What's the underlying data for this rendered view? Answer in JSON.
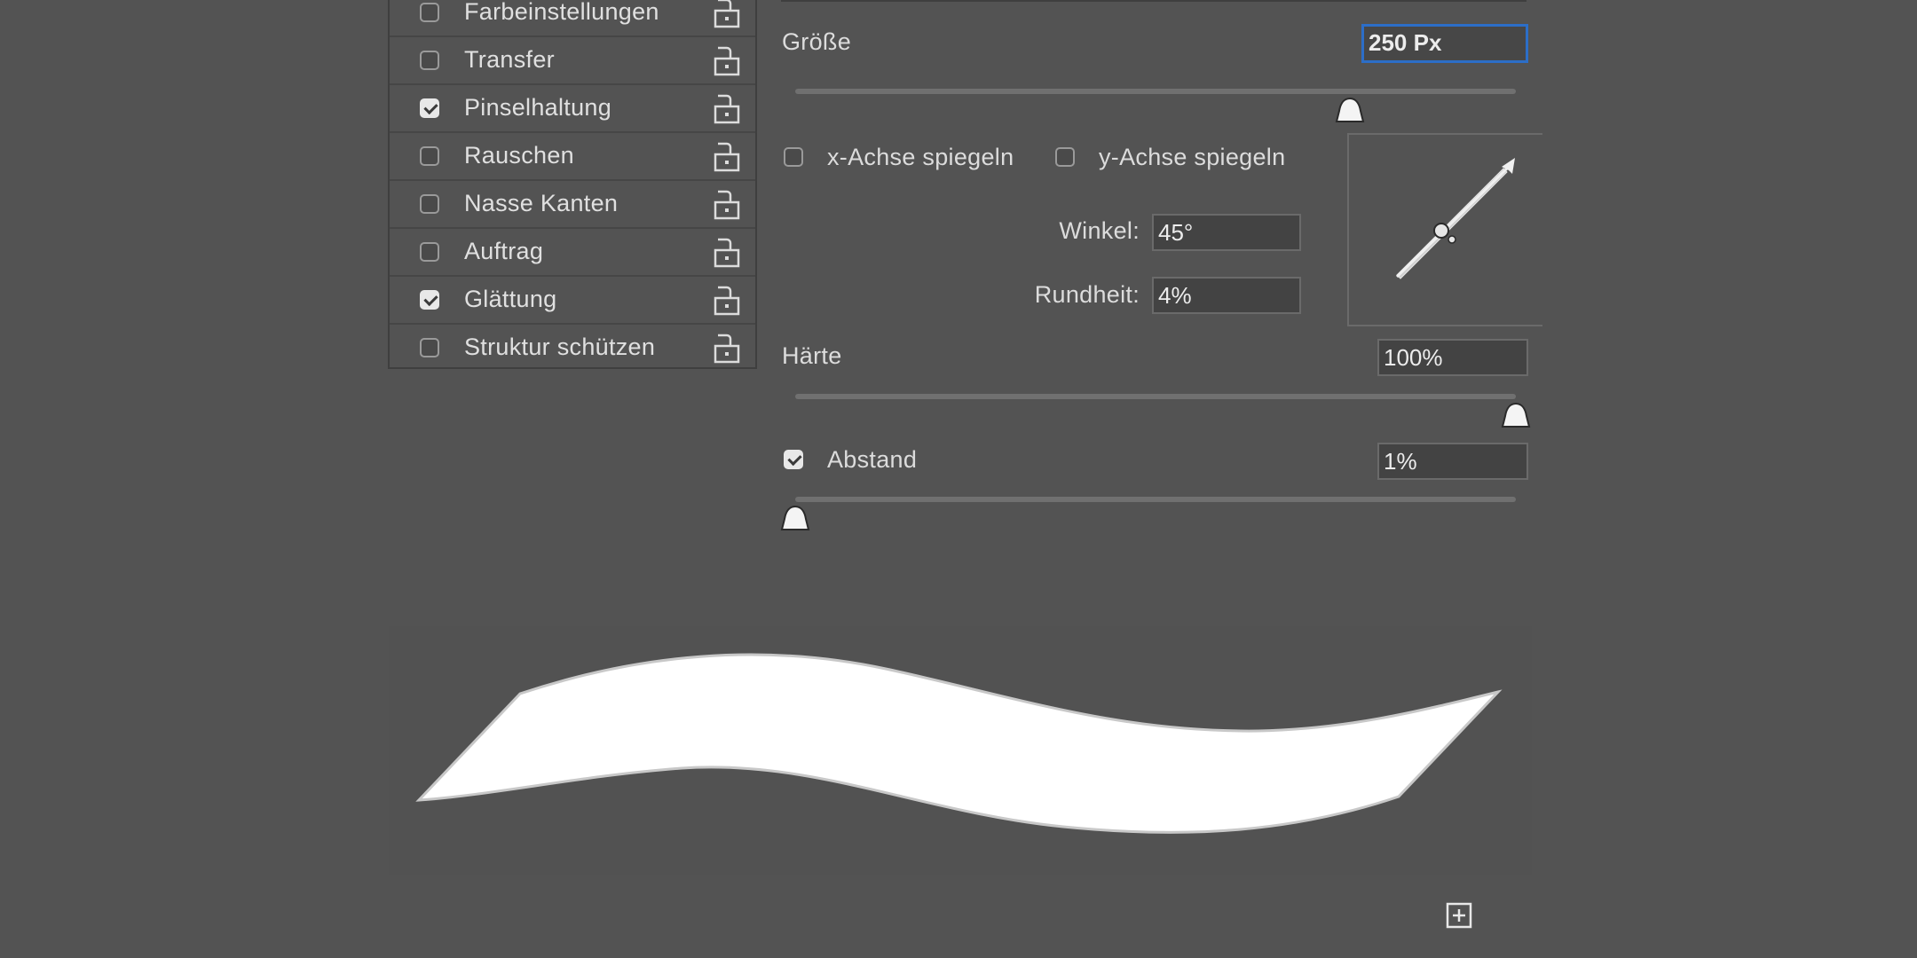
{
  "options": [
    {
      "label": "Farbeinstellungen",
      "checked": false
    },
    {
      "label": "Transfer",
      "checked": false
    },
    {
      "label": "Pinselhaltung",
      "checked": true
    },
    {
      "label": "Rauschen",
      "checked": false
    },
    {
      "label": "Nasse Kanten",
      "checked": false
    },
    {
      "label": "Auftrag",
      "checked": false
    },
    {
      "label": "Glättung",
      "checked": true
    },
    {
      "label": "Struktur schützen",
      "checked": false
    }
  ],
  "size": {
    "label": "Größe",
    "value": "250 Px",
    "slider_fraction": 0.77
  },
  "flip": {
    "x_label": "x-Achse spiegeln",
    "x_checked": false,
    "y_label": "y-Achse spiegeln",
    "y_checked": false
  },
  "angle": {
    "label": "Winkel:",
    "value": "45°"
  },
  "roundness": {
    "label": "Rundheit:",
    "value": "4%"
  },
  "hardness": {
    "label": "Härte",
    "value": "100%",
    "slider_fraction": 1.0
  },
  "spacing": {
    "label": "Abstand",
    "value": "1%",
    "checked": true,
    "slider_fraction": 0.0
  },
  "icons": {
    "lock": "unlock-icon",
    "thumb": "slider-thumb-icon",
    "new": "new-preset-icon"
  },
  "colors": {
    "background": "#535353",
    "focus": "#2c6ec8",
    "stroke": "#ffffff"
  }
}
